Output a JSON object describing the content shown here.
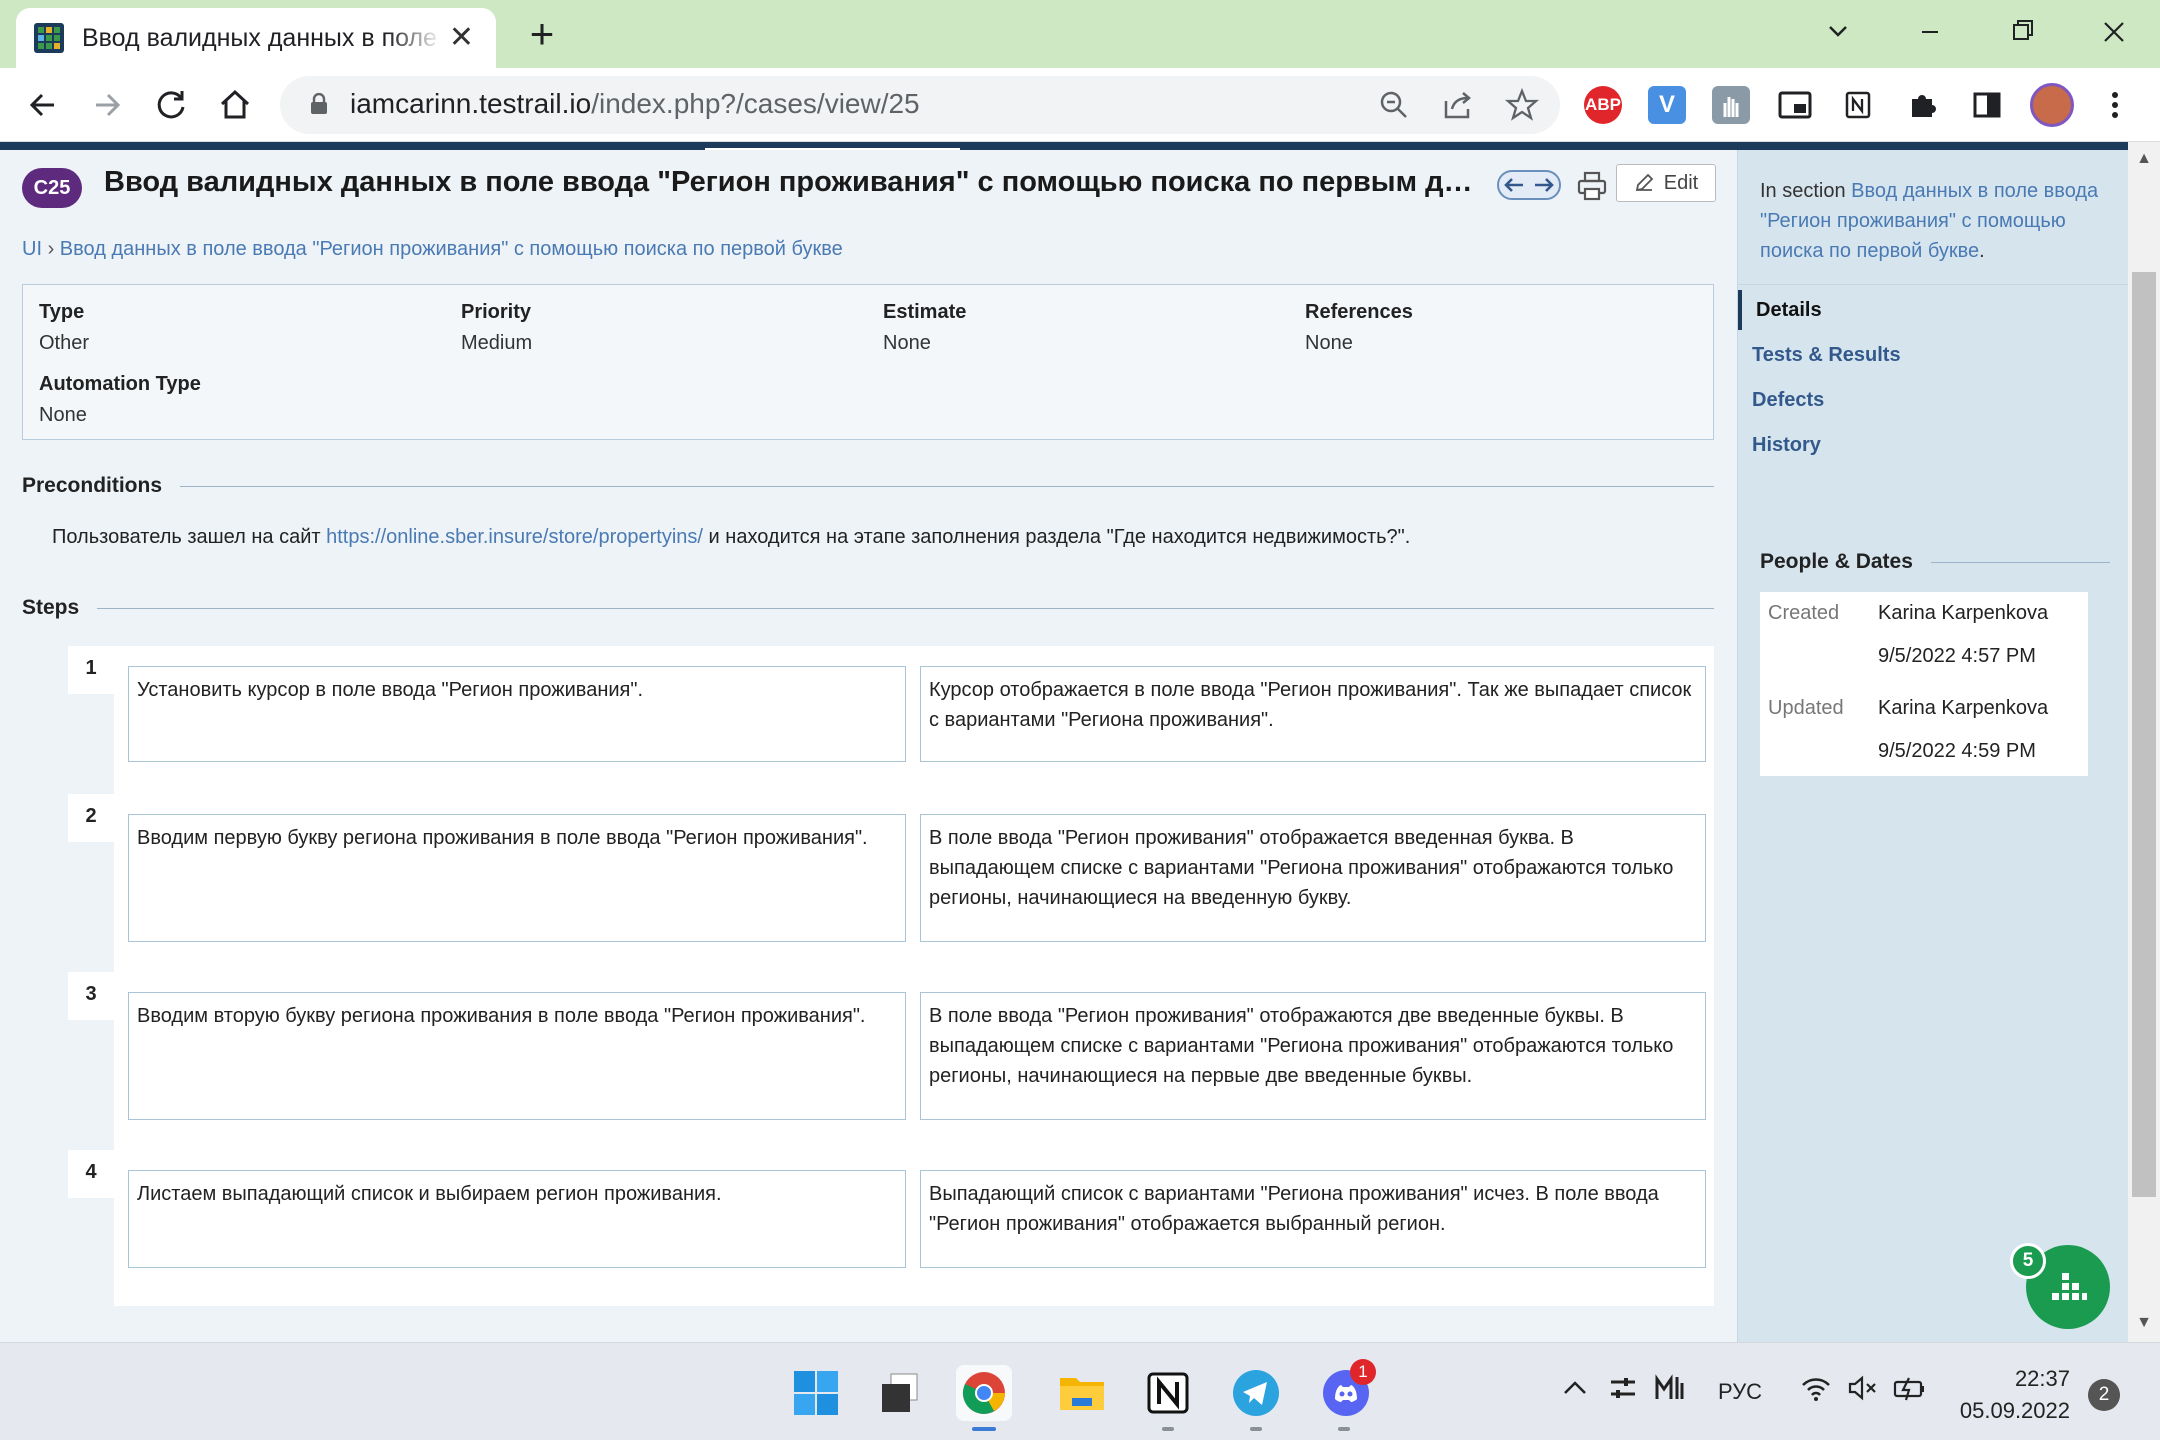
{
  "browser": {
    "tab_title": "Ввод валидных данных в поле ввода \"Регион проживания\"",
    "tab_close": "✕",
    "new_tab": "+",
    "url_host": "iamcarinn.testrail.io",
    "url_path": "/index.php?/cases/view/25",
    "extensions": [
      {
        "name": "adblock-plus",
        "label": "ABP",
        "color": "#e0262b"
      },
      {
        "name": "v-extension",
        "label": "V",
        "color": "#4a90e2"
      }
    ],
    "profile_color": "#c86b4a"
  },
  "case": {
    "badge": "C25",
    "title": "Ввод валидных данных в поле ввода \"Регион проживания\" с помощью поиска по первым двум буква...",
    "edit_label": "Edit",
    "breadcrumb_root": "UI",
    "breadcrumb_sep": "›",
    "breadcrumb_section": "Ввод данных в поле ввода \"Регион проживания\" с помощью поиска по первой букве",
    "fields": [
      {
        "label": "Type",
        "value": "Other"
      },
      {
        "label": "Priority",
        "value": "Medium"
      },
      {
        "label": "Estimate",
        "value": "None"
      },
      {
        "label": "References",
        "value": "None"
      },
      {
        "label": "Automation Type",
        "value": "None"
      }
    ],
    "preconditions_heading": "Preconditions",
    "preconditions_before": "Пользователь зашел на сайт ",
    "preconditions_link": "https://online.sber.insure/store/propertyins/",
    "preconditions_after": " и находится на этапе заполнения раздела \"Где находится недвижимость?\".",
    "steps_heading": "Steps",
    "steps": [
      {
        "num": "1",
        "action": "Установить курсор в поле ввода \"Регион проживания\".",
        "expected": "Курсор отображается в поле ввода \"Регион проживания\". Так же выпадает список с вариантами \"Региона проживания\"."
      },
      {
        "num": "2",
        "action": "Вводим первую букву региона проживания в поле ввода \"Регион проживания\".",
        "expected": "В поле ввода \"Регион проживания\" отображается введенная буква. В выпадающем списке с вариантами \"Региона проживания\" отображаются только регионы, начинающиеся на введенную букву."
      },
      {
        "num": "3",
        "action": "Вводим вторую букву региона проживания в поле ввода \"Регион проживания\".",
        "expected": "В поле ввода \"Регион проживания\" отображаются две введенные буквы. В выпадающем списке с вариантами \"Региона проживания\" отображаются только регионы, начинающиеся на первые две введенные буквы."
      },
      {
        "num": "4",
        "action": "Листаем выпадающий список и выбираем регион проживания.",
        "expected": "Выпадающий список с вариантами \"Региона проживания\" исчез. В поле ввода \"Регион проживания\" отображается выбранный регион."
      }
    ]
  },
  "sidebar": {
    "section_prefix": "In section ",
    "section_link": "Ввод данных в поле ввода \"Регион проживания\" с помощью поиска по первой букве",
    "section_suffix": ".",
    "nav": [
      "Details",
      "Tests & Results",
      "Defects",
      "History"
    ],
    "people_heading": "People & Dates",
    "created_label": "Created",
    "created_by": "Karina Karpenkova",
    "created_at": "9/5/2022 4:57 PM",
    "updated_label": "Updated",
    "updated_by": "Karina Karpenkova",
    "updated_at": "9/5/2022 4:59 PM"
  },
  "widget": {
    "badge": "5"
  },
  "taskbar": {
    "discord_badge": "1",
    "lang": "РУС",
    "time": "22:37",
    "date": "05.09.2022",
    "notifications": "2"
  }
}
